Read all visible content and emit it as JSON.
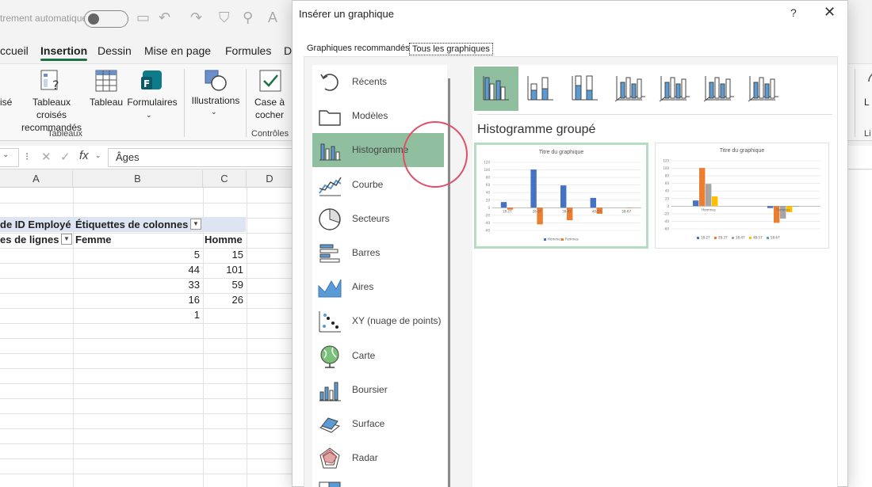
{
  "excel": {
    "autosave_label": "trement automatique",
    "menu_tabs": [
      "ccueil",
      "Insertion",
      "Dessin",
      "Mise en page",
      "Formules",
      "D"
    ],
    "ribbon": {
      "btn_partial": "isé",
      "tableaux_croises": "Tableaux croisés\nrecommandés",
      "tableau": "Tableau",
      "formulaires": "Formulaires",
      "illustrations": "Illustrations",
      "case_a_cocher": "Case à\ncocher",
      "group_tableaux": "Tableaux",
      "group_controles": "Contrôles",
      "right_partial": "L",
      "right_group_partial": "Li"
    },
    "formula_bar": {
      "fx": "fx",
      "value": "Âges"
    },
    "column_headers": [
      "A",
      "B",
      "C",
      "D"
    ],
    "pivot": {
      "row1_left": "de ID Employé",
      "row1_right": "Étiquettes de colonnes",
      "row2_left": "es de lignes",
      "col_femme": "Femme",
      "col_homme": "Homme",
      "rows": [
        {
          "femme": "5",
          "homme": "15"
        },
        {
          "femme": "44",
          "homme": "101"
        },
        {
          "femme": "33",
          "homme": "59"
        },
        {
          "femme": "16",
          "homme": "26"
        },
        {
          "femme": "1",
          "homme": ""
        }
      ]
    }
  },
  "dialog": {
    "title": "Insérer un graphique",
    "help": "?",
    "close": "✕",
    "tabs": [
      "Graphiques recommandés",
      "Tous les graphiques"
    ],
    "chart_types": [
      {
        "label": "Récents",
        "icon": "recent-icon"
      },
      {
        "label": "Modèles",
        "icon": "folder-icon"
      },
      {
        "label": "Histogramme",
        "icon": "column-chart-icon",
        "selected": true
      },
      {
        "label": "Courbe",
        "icon": "line-chart-icon"
      },
      {
        "label": "Secteurs",
        "icon": "pie-chart-icon"
      },
      {
        "label": "Barres",
        "icon": "bar-chart-icon"
      },
      {
        "label": "Aires",
        "icon": "area-chart-icon"
      },
      {
        "label": "XY (nuage de points)",
        "icon": "scatter-chart-icon"
      },
      {
        "label": "Carte",
        "icon": "globe-icon"
      },
      {
        "label": "Boursier",
        "icon": "stock-chart-icon"
      },
      {
        "label": "Surface",
        "icon": "surface-chart-icon"
      },
      {
        "label": "Radar",
        "icon": "radar-chart-icon"
      },
      {
        "label": "",
        "icon": "treemap-icon"
      }
    ],
    "selected_variant": "Histogramme groupé",
    "previews": [
      {
        "title": "Titre du graphique",
        "yticks": [
          "120",
          "100",
          "80",
          "60",
          "40",
          "20",
          "0",
          "-20",
          "-40",
          "-60"
        ],
        "categories": [
          "18-27",
          "28-37",
          "38-47",
          "48-57",
          "58-67"
        ],
        "legend": [
          "Hommes",
          "Femmes"
        ],
        "colors": [
          "#4472c4",
          "#ed7d31"
        ],
        "series": [
          {
            "values": [
              15,
              101,
              59,
              26,
              0
            ]
          },
          {
            "values": [
              -5,
              -44,
              -33,
              -16,
              -1
            ]
          }
        ]
      },
      {
        "title": "Titre du graphique",
        "yticks": [
          "120",
          "100",
          "80",
          "60",
          "40",
          "20",
          "0",
          "-20",
          "-40",
          "-60"
        ],
        "categories": [
          "Hommes",
          "Femmes"
        ],
        "legend": [
          "18-27",
          "28-37",
          "38-47",
          "48-57",
          "58-67"
        ],
        "colors": [
          "#4472c4",
          "#ed7d31",
          "#a5a5a5",
          "#ffc000",
          "#5b9bd5"
        ],
        "series": [
          {
            "values": [
              15,
              -5
            ]
          },
          {
            "values": [
              101,
              -44
            ]
          },
          {
            "values": [
              59,
              -33
            ]
          },
          {
            "values": [
              26,
              -16
            ]
          },
          {
            "values": [
              0,
              -1
            ]
          }
        ]
      }
    ]
  }
}
